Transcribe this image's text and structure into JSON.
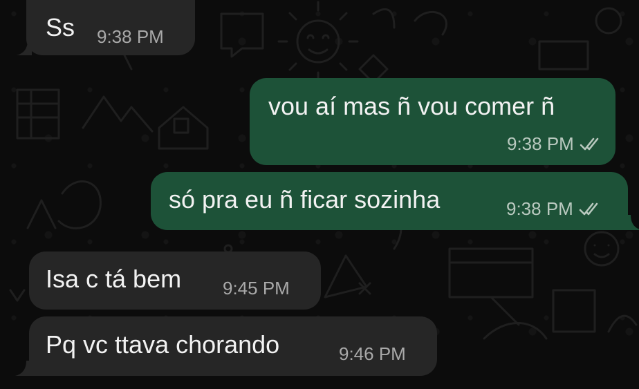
{
  "messages": [
    {
      "direction": "incoming",
      "text": "Ss",
      "time": "9:38 PM"
    },
    {
      "direction": "outgoing",
      "text": "vou aí mas ñ vou comer ñ",
      "time": "9:38 PM",
      "status_icon": "double-check-icon"
    },
    {
      "direction": "outgoing",
      "text": "só pra eu ñ ficar sozinha",
      "time": "9:38 PM",
      "status_icon": "double-check-icon"
    },
    {
      "direction": "incoming",
      "text": "Isa c tá bem",
      "time": "9:45 PM"
    },
    {
      "direction": "incoming",
      "text": "Pq vc ttava chorando",
      "time": "9:46 PM"
    }
  ],
  "colors": {
    "background": "#0c0c0c",
    "incoming_bubble": "#262626",
    "outgoing_bubble": "#1d5238",
    "text": "#f2f2f2",
    "timestamp": "#a9a9a9"
  }
}
